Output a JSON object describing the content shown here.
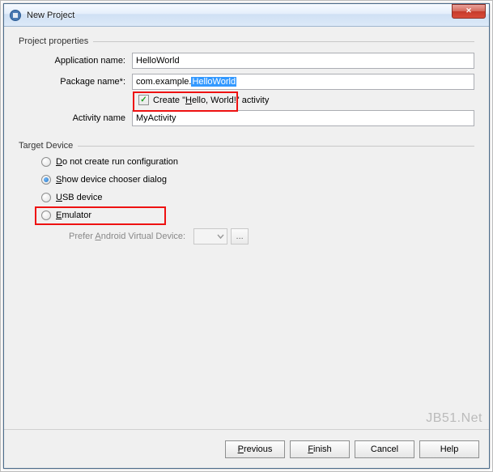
{
  "window": {
    "title": "New Project"
  },
  "properties": {
    "section_label": "Project properties",
    "app_name_label": "Application name:",
    "app_name_value": "HelloWorld",
    "pkg_label": "Package name*:",
    "pkg_prefix": "com.example.",
    "pkg_selected": "HelloWorld",
    "create_activity_pre": "Create \"",
    "create_activity_mnemonic": "H",
    "create_activity_post": "ello, World!\" activity",
    "activity_label": "Activity name",
    "activity_value": "MyActivity"
  },
  "target": {
    "section_label": "Target Device",
    "opt1_mnemonic": "D",
    "opt1_rest": "o not create run configuration",
    "opt2_mnemonic": "S",
    "opt2_rest": "how device chooser dialog",
    "opt3_mnemonic": "U",
    "opt3_rest": "SB device",
    "opt4_mnemonic": "E",
    "opt4_rest": "mulator",
    "avd_pre": "Prefer ",
    "avd_mnemonic": "A",
    "avd_post": "ndroid Virtual Device:",
    "ellipsis": "..."
  },
  "footer": {
    "previous_mnemonic": "P",
    "previous_rest": "revious",
    "finish_mnemonic": "F",
    "finish_rest": "inish",
    "cancel": "Cancel",
    "help": "Help"
  },
  "watermark": "JB51.Net"
}
